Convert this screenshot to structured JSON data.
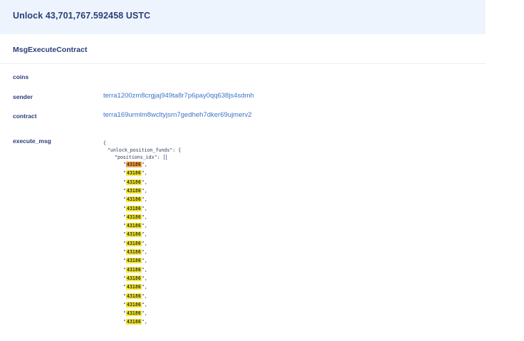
{
  "header": {
    "title": "Unlock 43,701,767.592458 USTC"
  },
  "message": {
    "type": "MsgExecuteContract"
  },
  "fields": {
    "coins": {
      "label": "coins",
      "value": ""
    },
    "sender": {
      "label": "sender",
      "value": "terra1200zm8crgjaj949ta8r7p6pay0qq638js4sdmh"
    },
    "contract": {
      "label": "contract",
      "value": "terra169urmlm8wcltyjsrn7gedheh7dker69ujmerv2"
    },
    "execute_msg": {
      "label": "execute_msg",
      "open_brace": "{",
      "outer_key": "\"unlock_position_funds\": {",
      "inner_key": "\"positions_idx\": [",
      "positions": [
        "43186",
        "43186",
        "43186",
        "43186",
        "43186",
        "43186",
        "43186",
        "43186",
        "43186",
        "43186",
        "43186",
        "43186",
        "43186",
        "43186",
        "43186",
        "43186",
        "43186",
        "43186",
        "43186"
      ]
    }
  }
}
